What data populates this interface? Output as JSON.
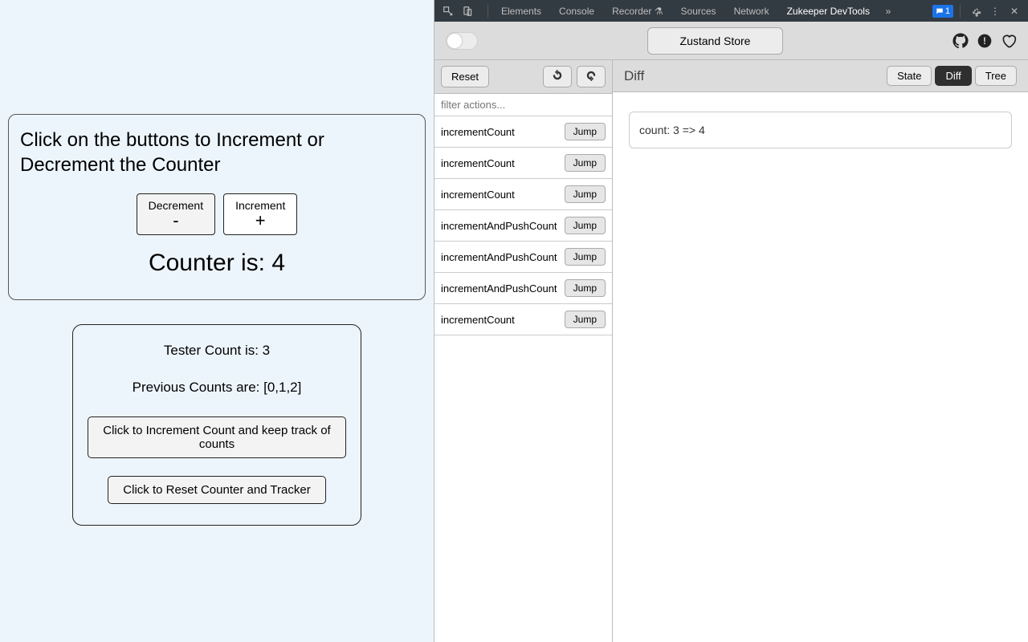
{
  "app": {
    "heading": "Click on the buttons to Increment or Decrement the Counter",
    "decrement_label": "Decrement",
    "decrement_symbol": "-",
    "increment_label": "Increment",
    "increment_symbol": "+",
    "counter_text": "Counter is: 4",
    "tester_count_text": "Tester Count is: 3",
    "prev_counts_text": "Previous Counts are: [0,1,2]",
    "track_btn": "Click to Increment Count and keep track of counts",
    "reset_btn": "Click to Reset Counter and Tracker"
  },
  "devtools": {
    "tabs": [
      "Elements",
      "Console",
      "Recorder",
      "Sources",
      "Network",
      "Zukeeper DevTools"
    ],
    "badge_count": "1",
    "store_btn": "Zustand Store",
    "reset_btn": "Reset",
    "filter_placeholder": "filter actions...",
    "jump_label": "Jump",
    "actions": [
      "incrementCount",
      "incrementCount",
      "incrementCount",
      "incrementAndPushCount",
      "incrementAndPushCount",
      "incrementAndPushCount",
      "incrementCount"
    ],
    "view_title": "Diff",
    "seg": {
      "state": "State",
      "diff": "Diff",
      "tree": "Tree"
    },
    "diff_content": "count: 3 => 4"
  }
}
